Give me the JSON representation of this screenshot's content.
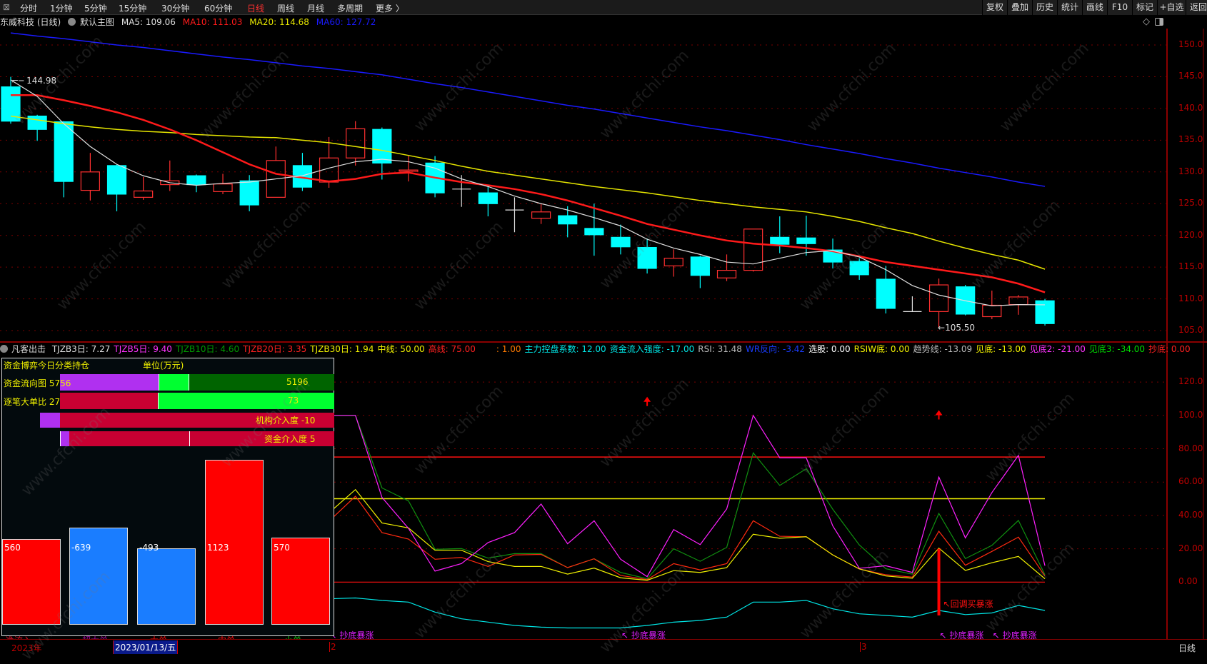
{
  "toolbar": {
    "periods": [
      "分时",
      "1分钟",
      "5分钟",
      "15分钟",
      "30分钟",
      "60分钟",
      "日线",
      "周线",
      "月线",
      "多周期",
      "更多 〉"
    ],
    "active_period": "日线",
    "right_buttons": [
      "复权",
      "叠加",
      "历史",
      "统计",
      "画线",
      "F10",
      "标记",
      "+自选",
      "返回"
    ]
  },
  "info": {
    "stock": "东威科技 (日线)",
    "template": "默认主图",
    "ma5": "MA5: 109.06",
    "ma10": "MA10: 111.03",
    "ma20": "MA20: 114.68",
    "ma60": "MA60: 127.72"
  },
  "colors": {
    "up": "#ff3030",
    "down": "#00ffff",
    "ma5": "#e0e0e0",
    "ma10": "#ff1a1a",
    "ma20": "#e6e600",
    "ma60": "#1a1aff",
    "axis": "#c00000"
  },
  "main_chart": {
    "price_axis": [
      "150.0",
      "145.0",
      "140.0",
      "135.0",
      "130.0",
      "125.0",
      "120.0",
      "115.0",
      "110.0",
      "105.0"
    ],
    "high_label": "144.98",
    "low_label": "105.50",
    "candles": [
      [
        143.4,
        144.98,
        137.6,
        138.0
      ],
      [
        138.8,
        139.0,
        134.9,
        136.7
      ],
      [
        137.9,
        138.0,
        126.0,
        128.5
      ],
      [
        127.1,
        133.0,
        125.5,
        130.0
      ],
      [
        131.0,
        131.2,
        123.8,
        126.5
      ],
      [
        126.0,
        129.2,
        125.6,
        127.0
      ],
      [
        128.0,
        131.8,
        127.0,
        128.6
      ],
      [
        129.4,
        129.6,
        126.8,
        128.0
      ],
      [
        126.9,
        129.7,
        126.5,
        128.1
      ],
      [
        128.6,
        129.5,
        123.8,
        124.8
      ],
      [
        126.0,
        134.0,
        126.0,
        131.8
      ],
      [
        131.0,
        133.0,
        127.0,
        127.6
      ],
      [
        128.4,
        135.5,
        127.5,
        132.2
      ],
      [
        132.2,
        138.0,
        131.0,
        136.8
      ],
      [
        136.7,
        137.0,
        128.8,
        131.4
      ],
      [
        130.1,
        132.5,
        128.5,
        130.3
      ],
      [
        131.4,
        132.5,
        126.0,
        126.7
      ],
      [
        127.3,
        129.5,
        124.5,
        127.3
      ],
      [
        126.7,
        128.0,
        123.0,
        125.0
      ],
      [
        124.0,
        126.0,
        120.5,
        124.0
      ],
      [
        122.7,
        125.0,
        121.8,
        123.7
      ],
      [
        123.1,
        124.6,
        119.7,
        121.8
      ],
      [
        121.1,
        125.0,
        116.8,
        120.1
      ],
      [
        119.7,
        121.7,
        117.0,
        118.2
      ],
      [
        118.1,
        119.5,
        114.0,
        114.8
      ],
      [
        115.2,
        117.8,
        113.5,
        116.4
      ],
      [
        116.6,
        116.8,
        111.7,
        113.7
      ],
      [
        113.3,
        117.0,
        112.8,
        114.5
      ],
      [
        114.5,
        121.0,
        114.3,
        121.0
      ],
      [
        119.7,
        123.0,
        117.2,
        118.6
      ],
      [
        119.6,
        123.1,
        116.8,
        118.7
      ],
      [
        117.7,
        119.5,
        114.8,
        115.8
      ],
      [
        115.9,
        116.4,
        113.0,
        113.8
      ],
      [
        113.1,
        115.2,
        107.7,
        108.5
      ],
      [
        108.0,
        110.4,
        108.0,
        108.0
      ],
      [
        108.0,
        113.2,
        105.5,
        112.2
      ],
      [
        111.9,
        112.2,
        107.4,
        107.6
      ],
      [
        107.2,
        111.3,
        106.8,
        109.0
      ],
      [
        109.1,
        110.6,
        107.5,
        110.3
      ],
      [
        109.7,
        110.0,
        105.8,
        106.1
      ]
    ],
    "ma5": [
      144.5,
      141.9,
      137.6,
      134.0,
      131.2,
      129.4,
      128.3,
      127.9,
      128.2,
      128.4,
      128.9,
      129.4,
      130.6,
      131.6,
      132.0,
      131.6,
      130.6,
      128.9,
      127.7,
      126.2,
      125.0,
      124.0,
      122.8,
      121.5,
      119.4,
      118.0,
      117.0,
      115.8,
      115.5,
      116.4,
      117.3,
      117.6,
      116.6,
      114.6,
      112.1,
      110.6,
      109.7,
      108.9,
      109.1,
      109.06
    ],
    "ma10": [
      142.1,
      142.1,
      141.3,
      140.4,
      139.4,
      138.2,
      136.7,
      135.0,
      133.1,
      131.2,
      129.7,
      129.1,
      128.5,
      128.9,
      129.7,
      129.9,
      129.1,
      128.4,
      127.9,
      127.3,
      126.5,
      125.5,
      124.3,
      123.1,
      121.8,
      120.9,
      120.0,
      119.2,
      118.7,
      118.4,
      118.0,
      117.5,
      116.7,
      115.8,
      115.2,
      114.6,
      114.0,
      113.4,
      112.4,
      111.03
    ],
    "ma20": [
      138.8,
      138.2,
      137.6,
      137.1,
      136.7,
      136.4,
      136.2,
      135.9,
      135.7,
      135.5,
      135.4,
      135.0,
      134.6,
      134.0,
      133.4,
      132.6,
      131.8,
      130.9,
      130.1,
      129.5,
      128.9,
      128.3,
      127.7,
      127.2,
      126.7,
      126.1,
      125.5,
      125.0,
      124.5,
      124.1,
      123.7,
      123.0,
      122.2,
      121.2,
      120.3,
      119.1,
      118.0,
      117.0,
      116.1,
      114.68
    ],
    "ma60": [
      151.9,
      151.4,
      151.0,
      150.5,
      150.0,
      149.6,
      149.1,
      148.6,
      148.1,
      147.7,
      147.2,
      146.7,
      146.3,
      145.8,
      145.3,
      144.6,
      143.9,
      143.3,
      142.6,
      141.9,
      141.2,
      140.5,
      139.9,
      139.2,
      138.5,
      137.8,
      137.1,
      136.5,
      135.8,
      135.1,
      134.3,
      133.6,
      132.9,
      132.1,
      131.4,
      130.6,
      129.9,
      129.2,
      128.4,
      127.72
    ]
  },
  "indicator": {
    "name": "凡客出击",
    "values": [
      {
        "text": "TJZB3日: 7.27",
        "color": "#e0e0e0"
      },
      {
        "text": "TJZB5日: 9.40",
        "color": "#ff33ff"
      },
      {
        "text": "TJZB10日: 4.60",
        "color": "#009900"
      },
      {
        "text": "TJZB20日: 3.35",
        "color": "#ff2020"
      },
      {
        "text": "TJZB30日: 1.94",
        "color": "#f0f000"
      },
      {
        "text": "中线: 50.00",
        "color": "#f0f000"
      },
      {
        "text": "高线: 75.00",
        "color": "#ff2020"
      },
      {
        "text": ": 1.00",
        "color": "#ff7a00"
      },
      {
        "text": "主力控盘系数: 12.00",
        "color": "#00e5e5"
      },
      {
        "text": "资金流入强度: -17.00",
        "color": "#00e5e5"
      },
      {
        "text": "RSI: 31.48",
        "color": "#bbbbbb"
      },
      {
        "text": "WR反向: -3.42",
        "color": "#1a3cff"
      },
      {
        "text": "选股: 0.00",
        "color": "#ffffff"
      },
      {
        "text": "RSIW底: 0.00",
        "color": "#f0f000"
      },
      {
        "text": "趋势线: -13.09",
        "color": "#bbbbbb"
      },
      {
        "text": "见底: -13.00",
        "color": "#f0f000"
      },
      {
        "text": "见底2: -21.00",
        "color": "#ff33ff"
      },
      {
        "text": "见底3: -34.00",
        "color": "#00dd00"
      },
      {
        "text": "抄底: 0.00",
        "color": "#ff2020"
      }
    ],
    "axis": [
      "120.0",
      "100.0",
      "80.00",
      "60.00",
      "40.00",
      "20.00",
      "0.00"
    ],
    "mid_line": 50,
    "high_line": 75,
    "start_index": 12,
    "series": {
      "tjzb5": [
        100,
        100,
        50.8,
        32.2,
        6.6,
        11.1,
        23.7,
        29.7,
        46.8,
        23.0,
        36.8,
        13.7,
        3.3,
        31.5,
        22.5,
        43.9,
        100,
        74.6,
        74.6,
        33.7,
        8.3,
        9.8,
        5.8,
        63.0,
        26.5,
        53.7,
        76.0,
        9.8
      ],
      "tjzb10": [
        100,
        100,
        56.5,
        48.7,
        19.7,
        20.1,
        14.4,
        17.1,
        17.1,
        8.7,
        14.0,
        5.8,
        2.0,
        20.0,
        12.5,
        20.8,
        77.5,
        58.0,
        68.0,
        43.7,
        22.3,
        8.0,
        4.8,
        41.2,
        14.1,
        22.0,
        37.0,
        4.4
      ],
      "tjzb20": [
        36.5,
        51.5,
        29.7,
        25.8,
        13.7,
        14.8,
        9.4,
        16.3,
        16.6,
        8.7,
        14.0,
        4.0,
        1.5,
        11.1,
        7.3,
        11.1,
        36.8,
        27.5,
        27.2,
        16.3,
        7.9,
        4.4,
        3.0,
        30.5,
        10.1,
        18.4,
        27.0,
        3.7
      ],
      "tjzb30": [
        41.5,
        55.5,
        35.5,
        32.5,
        19.1,
        19.1,
        12.3,
        9.4,
        9.4,
        4.8,
        8.4,
        2.6,
        1.1,
        6.9,
        5.8,
        8.7,
        28.7,
        26.3,
        27.2,
        16.3,
        7.9,
        3.7,
        2.3,
        20.4,
        7.0,
        11.6,
        15.4,
        2.0
      ],
      "strength": [
        -10,
        -9.5,
        -11,
        -12,
        -18,
        -22,
        -24,
        -26,
        -27,
        -27.5,
        -27.5,
        -27.5,
        -26,
        -24,
        -23,
        -21,
        -12,
        -12,
        -11,
        -16,
        -19,
        -20,
        -21,
        -17,
        -19.5,
        -18.5,
        -14,
        -17
      ]
    },
    "buy_arrows": [
      24,
      35
    ],
    "signal_bar_index": 35,
    "signal_label": "回调买暴涨",
    "bottom_signal_label": "抄底暴涨",
    "bottom_signal_indices": [
      12,
      23,
      35,
      37
    ]
  },
  "fund_panel": {
    "title": "资金博弈今日分类持仓",
    "unit": "单位(万元)",
    "rows": [
      {
        "label": "资金流向图 5756",
        "right": "5196"
      },
      {
        "label": "逐笔大单比 27",
        "right": "73"
      },
      {
        "label": "",
        "right": "机构介入度 -10"
      },
      {
        "label": "",
        "right": "资金介入度 5"
      }
    ],
    "bars": [
      {
        "category": "净流入",
        "value": 560,
        "color": "#ff0000",
        "label_color": "#d0102a"
      },
      {
        "category": "超大单",
        "value": -639,
        "color": "#1a7dff",
        "label_color": "#a0109f"
      },
      {
        "category": "大单",
        "value": -493,
        "color": "#1a7dff",
        "label_color": "#ff1010"
      },
      {
        "category": "中单",
        "value": 1123,
        "color": "#ff0000",
        "label_color": "#ff1010"
      },
      {
        "category": "小单",
        "value": 570,
        "color": "#ff0000",
        "label_color": "#10d010"
      }
    ]
  },
  "bottom_axis": {
    "year": "2023年",
    "cursor_date": "2023/01/13/五",
    "month2": "2",
    "month3": "3",
    "period": "日线"
  },
  "watermark": "www.cfchi.com"
}
